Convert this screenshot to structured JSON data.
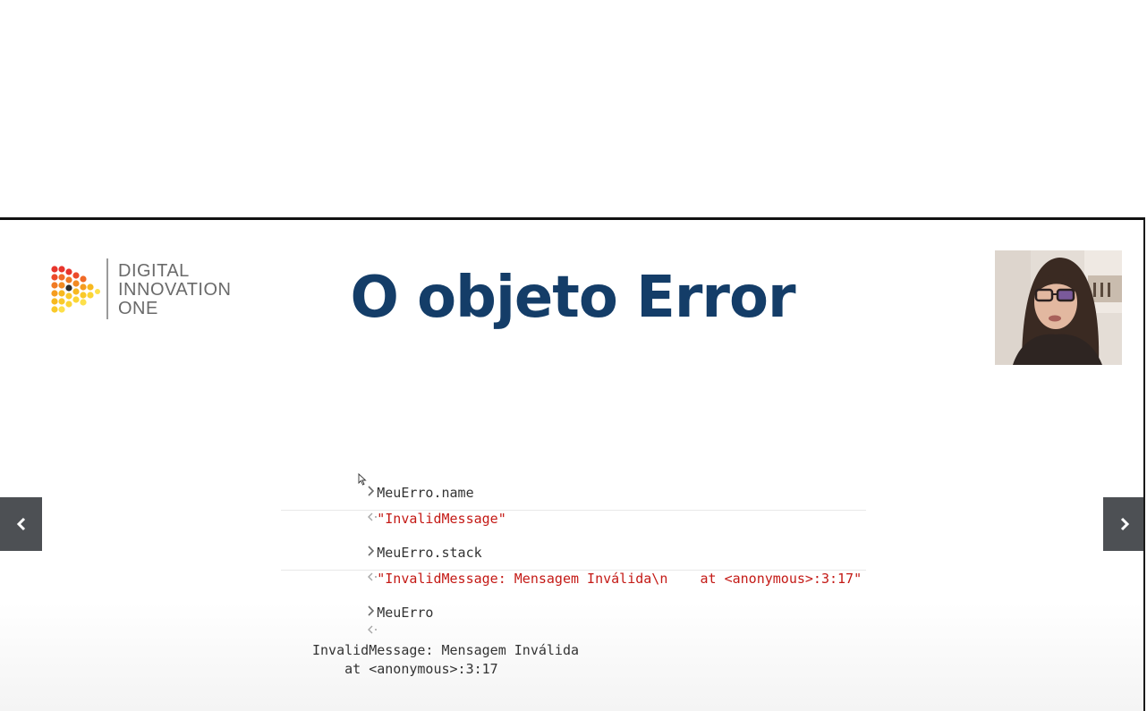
{
  "logo": {
    "line1": "DIGITAL",
    "line2": "INNOVATION",
    "line3": "ONE",
    "colors": [
      "#e8352c",
      "#f07a24",
      "#f7b81f",
      "#fde04a"
    ]
  },
  "slide": {
    "title": "O objeto Error",
    "title_color": "#143d68"
  },
  "console": {
    "entries": [
      {
        "input": "MeuErro.name",
        "output": "\"InvalidMessage\""
      },
      {
        "input": "MeuErro.stack",
        "output": "\"InvalidMessage: Mensagem Inválida\\n    at <anonymous>:3:17\""
      },
      {
        "input": "MeuErro",
        "output_line1": "InvalidMessage: Mensagem Inválida",
        "output_line2": "    at <anonymous>:3:17"
      }
    ],
    "input_prompt": "›",
    "output_prompt": "‹·"
  },
  "nav": {
    "prev_icon": "chevron-left-icon",
    "next_icon": "chevron-right-icon"
  },
  "webcam": {
    "description_icon": "presenter-video"
  }
}
